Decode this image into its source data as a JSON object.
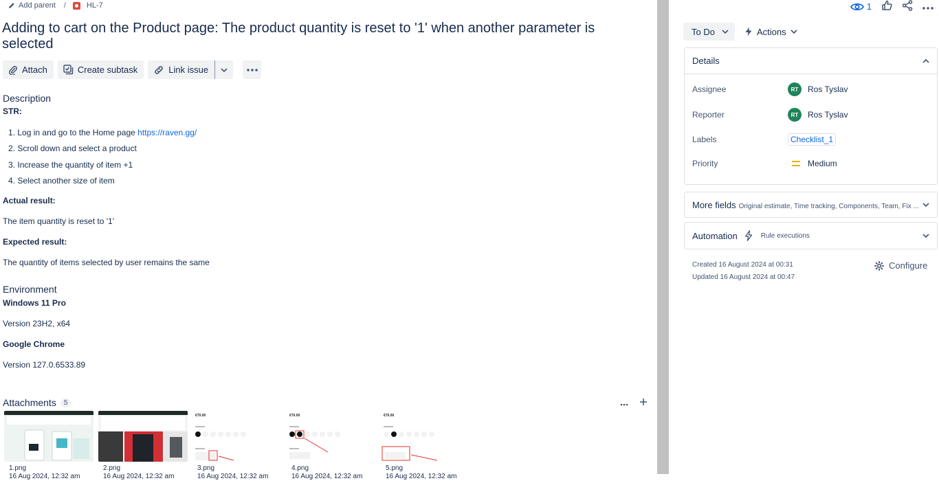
{
  "breadcrumb": {
    "add_parent": "Add parent",
    "issue_key": "HL-7"
  },
  "issue": {
    "title": "Adding to cart on the Product page: The product quantity is reset to '1' when another parameter is selected"
  },
  "toolbar": {
    "attach": "Attach",
    "create_subtask": "Create subtask",
    "link_issue": "Link issue"
  },
  "description": {
    "heading": "Description",
    "str_label": "STR:",
    "steps": [
      {
        "num": "1.",
        "text": "Log in and go to the Home page ",
        "link": "https://raven.gg/"
      },
      {
        "num": "2.",
        "text": "Scroll down and select a product"
      },
      {
        "num": "3.",
        "text": "Increase the quantity of item +1"
      },
      {
        "num": "4.",
        "text": "Select another size of item"
      }
    ],
    "actual_label": "Actual result:",
    "actual_text": "The item quantity is reset to '1'",
    "expected_label": "Expected result:",
    "expected_text": "The quantity of items selected by user remains the same"
  },
  "environment": {
    "heading": "Environment",
    "os": "Windows 11 Pro",
    "os_version": "Version 23H2, x64",
    "browser": "Google Chrome",
    "browser_version": "Version 127.0.6533.89"
  },
  "attachments": {
    "heading": "Attachments",
    "count": "5",
    "items": [
      {
        "name": "1.png",
        "date": "16 Aug 2024, 12:32 am"
      },
      {
        "name": "2.png",
        "date": "16 Aug 2024, 12:32 am"
      },
      {
        "name": "3.png",
        "date": "16 Aug 2024, 12:32 am",
        "price": "€70.00"
      },
      {
        "name": "4.png",
        "date": "16 Aug 2024, 12:32 am",
        "price": "€70.00"
      },
      {
        "name": "5.png",
        "date": "16 Aug 2024, 12:32 am",
        "price": "€70.00"
      }
    ]
  },
  "top_actions": {
    "watchers": "1"
  },
  "status": {
    "label": "To Do"
  },
  "actions": {
    "label": "Actions"
  },
  "details": {
    "heading": "Details",
    "assignee_label": "Assignee",
    "assignee_name": "Ros Tyslav",
    "assignee_initials": "RT",
    "reporter_label": "Reporter",
    "reporter_name": "Ros Tyslav",
    "reporter_initials": "RT",
    "labels_label": "Labels",
    "labels_value": "Checklist_1",
    "priority_label": "Priority",
    "priority_value": "Medium"
  },
  "more_fields": {
    "label": "More fields",
    "sub": "Original estimate, Time tracking, Components, Team, Fix ..."
  },
  "automation": {
    "label": "Automation",
    "sub": "Rule executions"
  },
  "meta": {
    "created": "Created 16 August 2024 at 00:31",
    "updated": "Updated 16 August 2024 at 00:47",
    "configure": "Configure"
  },
  "colors": {
    "link": "#0c66e4",
    "avatar": "#1f845a",
    "bug": "#e2483d",
    "priority_medium": "#e2b203"
  }
}
